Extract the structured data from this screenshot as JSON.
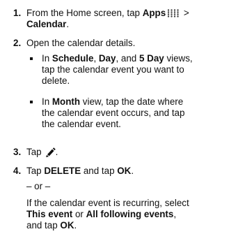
{
  "steps": [
    {
      "num": "1.",
      "line1_pre": "From the Home screen, tap ",
      "line1_bold": "Apps",
      "line1_post": " >",
      "line2_bold": "Calendar",
      "line2_post": "."
    },
    {
      "num": "2.",
      "text": "Open the calendar details.",
      "bullets": [
        {
          "pre": "In ",
          "b1": "Schedule",
          "s1": ", ",
          "b2": "Day",
          "s2": ", and ",
          "b3": "5 Day",
          "s3": " views,",
          "line2": "tap the calendar event you want to",
          "line3": "delete."
        },
        {
          "pre": "In ",
          "b1": "Month",
          "post": " view, tap the date where",
          "line2": "the calendar event occurs, and tap",
          "line3": "the calendar event."
        }
      ]
    },
    {
      "num": "3.",
      "pre": "Tap",
      "post": "."
    },
    {
      "num": "4.",
      "pre": "Tap ",
      "b1": "DELETE",
      "mid": " and tap ",
      "b2": "OK",
      "post": ".",
      "or_text": "– or –",
      "rec_line1": "If the calendar event is recurring, select",
      "rec_b1": "This event",
      "rec_mid": " or ",
      "rec_b2": "All following events",
      "rec_comma": ",",
      "rec_line3_pre": "and tap ",
      "rec_b3": "OK",
      "rec_line3_post": "."
    }
  ],
  "icons": {
    "apps": "apps-grid-icon",
    "edit": "pencil-edit-icon"
  }
}
